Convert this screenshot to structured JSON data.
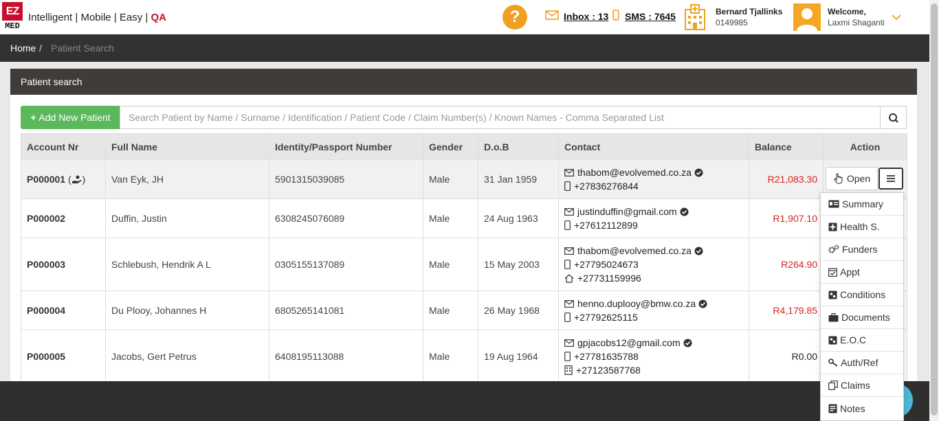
{
  "app": {
    "logo_top": "EZ",
    "logo_bottom": "MED",
    "tagline": "Intelligent | Mobile | Easy | ",
    "env": "QA"
  },
  "header": {
    "help_symbol": "?",
    "inbox": "Inbox : 13",
    "sms": "SMS : 7645",
    "practice_name": "Bernard Tjallinks",
    "practice_number": "0149985",
    "welcome": "Welcome,",
    "user_name": "Laxmi Shaganti"
  },
  "breadcrumb": {
    "home": "Home",
    "separator": "/",
    "current": "Patient Search"
  },
  "panel": {
    "title": "Patient search",
    "add_button": "Add New Patient",
    "search_placeholder": "Search Patient by Name / Surname / Identification / Patient Code / Claim Number(s) / Known Names - Comma Separated List"
  },
  "table": {
    "headers": [
      "Account Nr",
      "Full Name",
      "Identity/Passport Number",
      "Gender",
      "D.o.B",
      "Contact",
      "Balance",
      "Action"
    ],
    "rows": [
      {
        "account": "P000001",
        "account_suffix": "( )",
        "name": "Van Eyk, JH",
        "id": "5901315039085",
        "gender": "Male",
        "dob": "31 Jan 1959",
        "email": "thabom@evolvemed.co.za",
        "mobile": "+27836276844",
        "balance": "R21,083.30"
      },
      {
        "account": "P000002",
        "name": "Duffin, Justin",
        "id": "6308245076089",
        "gender": "Male",
        "dob": "24 Aug 1963",
        "email": "justinduffin@gmail.com",
        "mobile": "+27612112899",
        "balance": "R1,907.10"
      },
      {
        "account": "P000003",
        "name": "Schlebush, Hendrik A L",
        "id": "0305155137089",
        "gender": "Male",
        "dob": "15 May 2003",
        "email": "thabom@evolvemed.co.za",
        "mobile": "+27795024673",
        "home": "+27731159996",
        "balance": "R264.90"
      },
      {
        "account": "P000004",
        "name": "Du Plooy, Johannes H",
        "id": "6805265141081",
        "gender": "Male",
        "dob": "26 May 1968",
        "email": "henno.duplooy@bmw.co.za",
        "mobile": "+27792625115",
        "balance": "R4,179.85"
      },
      {
        "account": "P000005",
        "name": "Jacobs, Gert Petrus",
        "id": "6408195113088",
        "gender": "Male",
        "dob": "19 Aug 1964",
        "email": "gpjacobs12@gmail.com",
        "mobile": "+27781635788",
        "work": "+27123587768",
        "balance": "R0.00"
      }
    ]
  },
  "actions": {
    "open": "Open"
  },
  "action_menu": {
    "items": [
      "Summary",
      "Health S.",
      "Funders",
      "Appt",
      "Conditions",
      "Documents",
      "E.O.C",
      "Auth/Ref",
      "Claims",
      "Notes"
    ]
  },
  "colors": {
    "brand_red": "#c8102e",
    "help_orange": "#f0a020",
    "add_green": "#5cb85c",
    "balance_red": "#d9231d",
    "dark_bar": "#333131"
  }
}
